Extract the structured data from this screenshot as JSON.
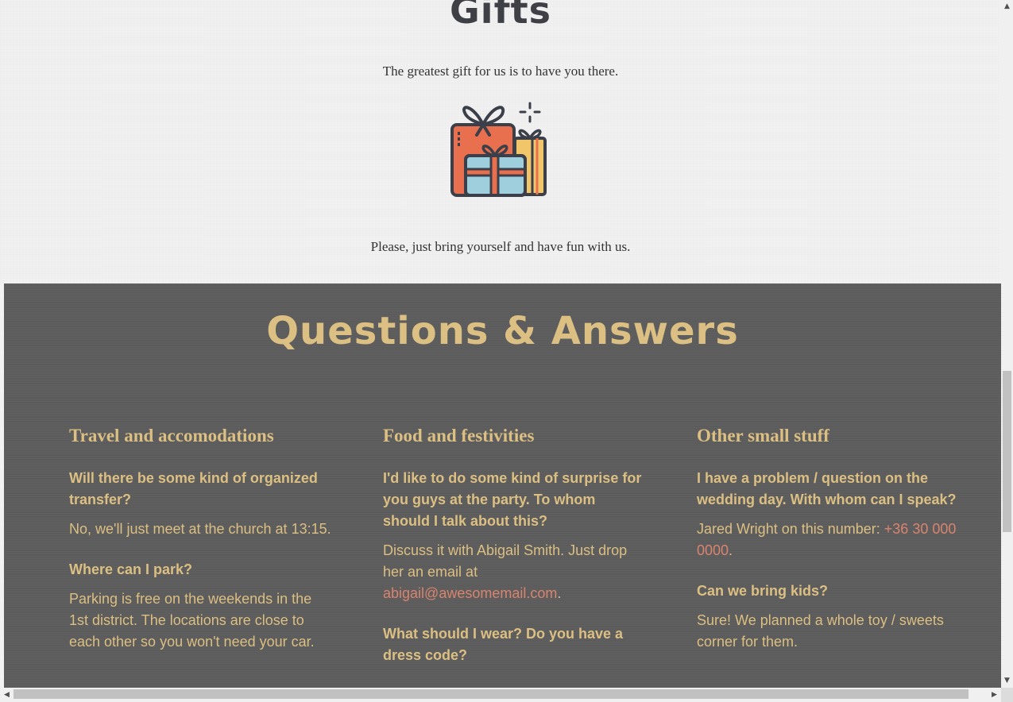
{
  "gifts": {
    "title": "Gifts",
    "subtitle": "The greatest gift for us is to have you there.",
    "illustration_icon": "gift-boxes-icon",
    "note": "Please, just bring yourself and have fun with us."
  },
  "qa": {
    "title": "Questions & Answers",
    "columns": [
      {
        "heading": "Travel and accomodations",
        "items": [
          {
            "question": "Will there be some kind of organized transfer?",
            "answer": "No, we'll just meet at the church at 13:15."
          },
          {
            "question": "Where can I park?",
            "answer": "Parking is free on the weekends in the 1st district. The locations are close to each other so you won't need your car."
          }
        ]
      },
      {
        "heading": "Food and festivities",
        "items": [
          {
            "question": "I'd like to do some kind of surprise for you guys at the party. To whom should I talk about this?",
            "answer_prefix": "Discuss it with Abigail Smith. Just drop her an email at ",
            "answer_link": "abigail@awesomemail.com",
            "answer_suffix": "."
          },
          {
            "question": "What should I wear? Do you have a dress code?"
          }
        ]
      },
      {
        "heading": "Other small stuff",
        "items": [
          {
            "question": "I have a problem / question on the wedding day. With whom can I speak?",
            "answer_prefix": "Jared Wright on this number: ",
            "answer_link": "+36 30 000 0000",
            "answer_suffix": "."
          },
          {
            "question": "Can we bring kids?",
            "answer": "Sure! We planned a whole toy / sweets corner for them."
          }
        ]
      }
    ]
  },
  "colors": {
    "gold": "#dcbf82",
    "link": "#d9846f",
    "qa_background": "#5c5c5c",
    "title_dark": "#3f3f46"
  },
  "scrollbars": {
    "up_icon": "arrow-up-icon",
    "down_icon": "arrow-down-icon",
    "left_icon": "arrow-left-icon",
    "right_icon": "arrow-right-icon"
  }
}
